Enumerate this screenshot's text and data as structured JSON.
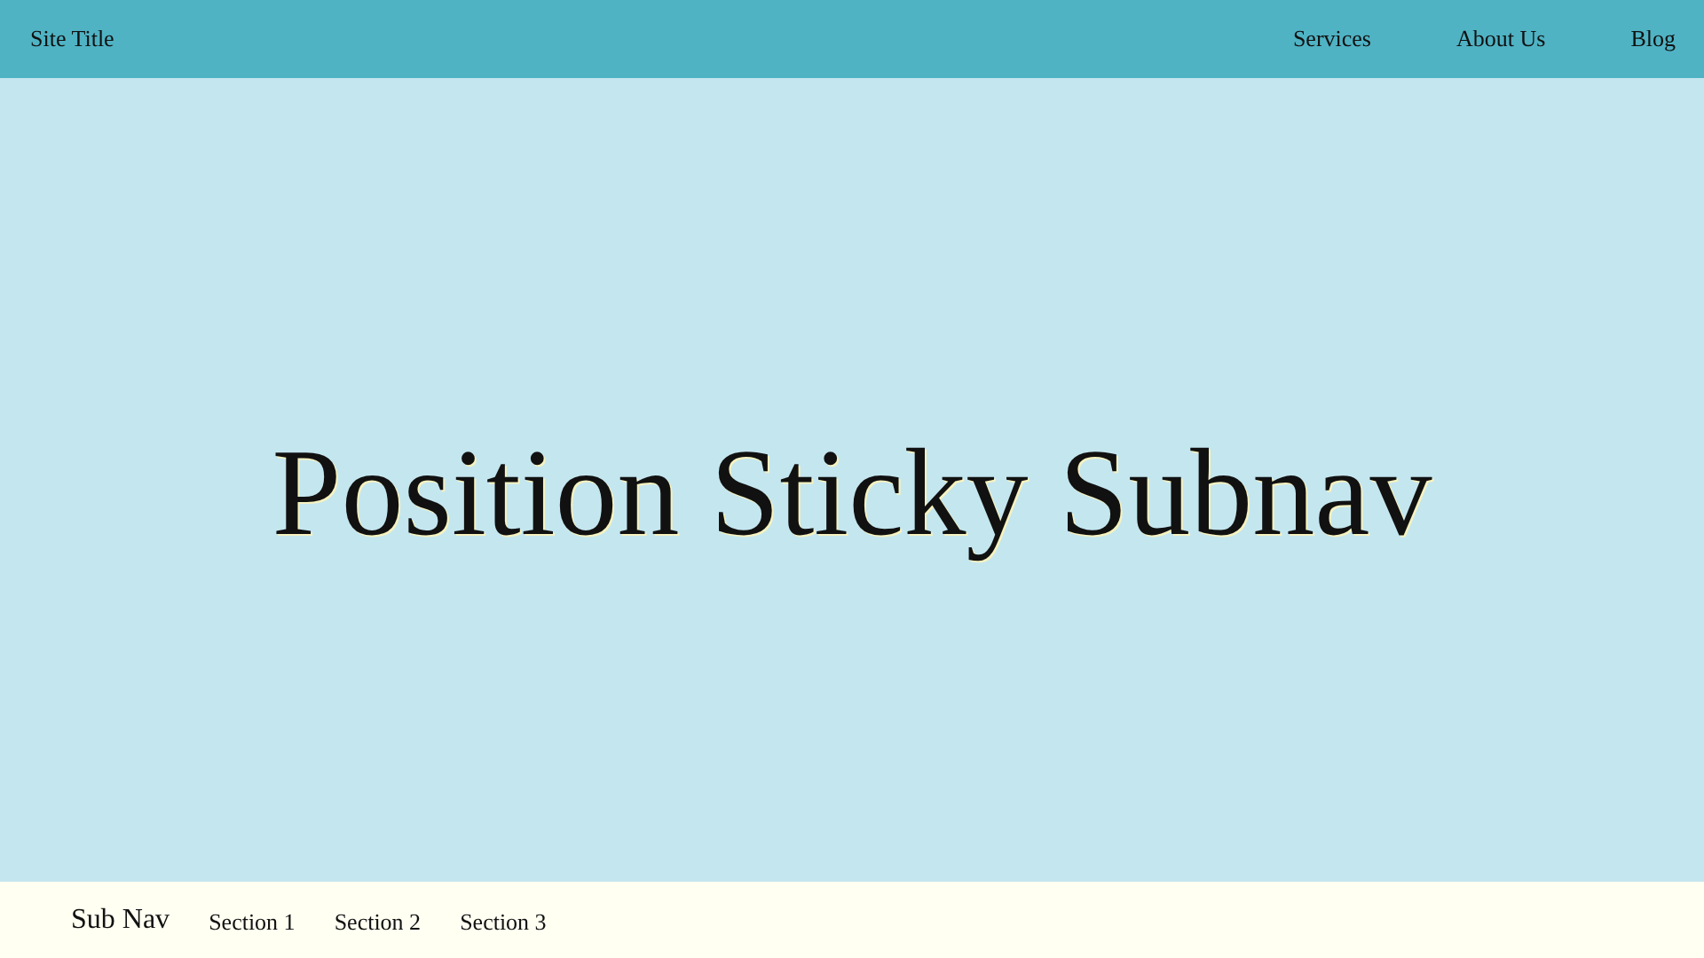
{
  "header": {
    "site_title": "Site Title",
    "nav": [
      {
        "label": "Services"
      },
      {
        "label": "About Us"
      },
      {
        "label": "Blog"
      }
    ]
  },
  "hero": {
    "heading": "Position Sticky Subnav"
  },
  "subnav": {
    "title": "Sub Nav",
    "links": [
      {
        "label": "Section 1"
      },
      {
        "label": "Section 2"
      },
      {
        "label": "Section 3"
      }
    ]
  }
}
